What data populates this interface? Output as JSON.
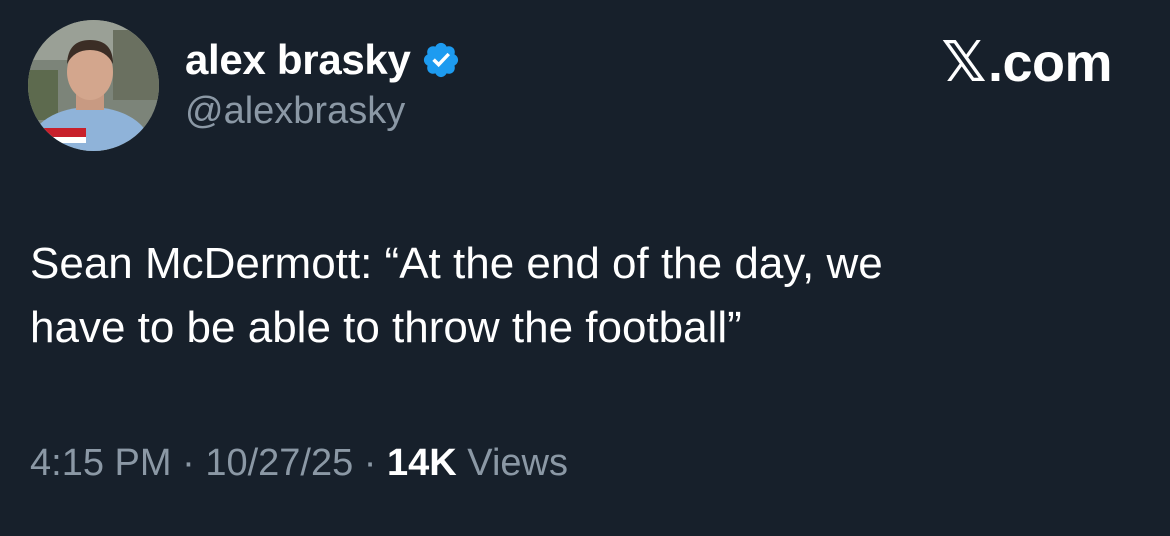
{
  "author": {
    "display_name": "alex brasky",
    "handle": "@alexbrasky",
    "verified": true,
    "verified_color": "#1d9bf0",
    "avatar_icon": "profile-photo"
  },
  "brand": {
    "mark": "𝕏",
    "suffix": ".com"
  },
  "tweet": {
    "line1": "Sean McDermott: “At the end of the day, we",
    "line2": "have to be able to throw the football”"
  },
  "meta": {
    "time": "4:15 PM",
    "separator": " · ",
    "date": "10/27/25",
    "views_count": "14K",
    "views_label": "Views"
  },
  "colors": {
    "background": "#17202b",
    "text": "#ffffff",
    "secondary": "#8b98a5"
  }
}
